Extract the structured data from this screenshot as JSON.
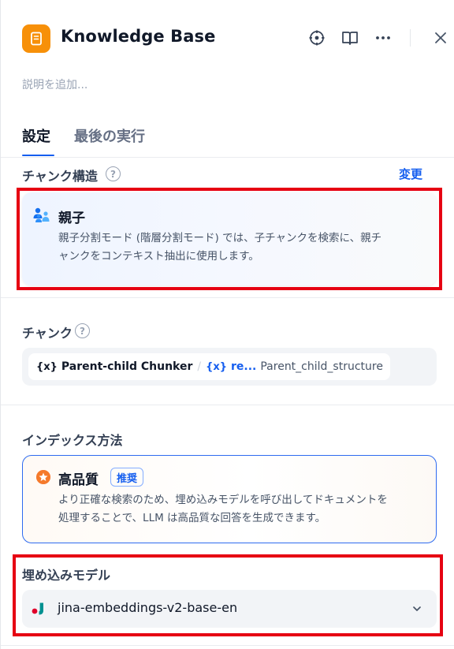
{
  "header": {
    "title": "Knowledge Base",
    "description_placeholder": "説明を追加...",
    "icons": [
      "book-icon",
      "locate-icon",
      "book-open-icon",
      "more-icon",
      "close-icon"
    ]
  },
  "tabs": [
    {
      "label": "設定",
      "active": true
    },
    {
      "label": "最後の実行",
      "active": false
    }
  ],
  "chunk_structure": {
    "label": "チャンク構造",
    "change_label": "変更",
    "option": {
      "title": "親子",
      "description_line1": "親子分割モード (階層分割モード) では、子チャンクを検索に、親チ",
      "description_line2": "ャンクをコンテキスト抽出に使用します。"
    }
  },
  "chunks": {
    "label": "チャンク",
    "node_name": "Parent-child Chunker",
    "var_name": "re...",
    "field_name": "Parent_child_structure"
  },
  "index_method": {
    "label": "インデックス方法",
    "option": {
      "title": "高品質",
      "badge": "推奨",
      "description_line1": "より正確な検索のため、埋め込みモデルを呼び出してドキュメントを",
      "description_line2": "処理することで、LLM は高品質な回答を生成できます。"
    }
  },
  "embedding_model": {
    "label": "埋め込みモデル",
    "value": "jina-embeddings-v2-base-en"
  },
  "colors": {
    "accent": "#155eef",
    "app_icon": "#f79009",
    "highlight_border": "#e60012"
  }
}
